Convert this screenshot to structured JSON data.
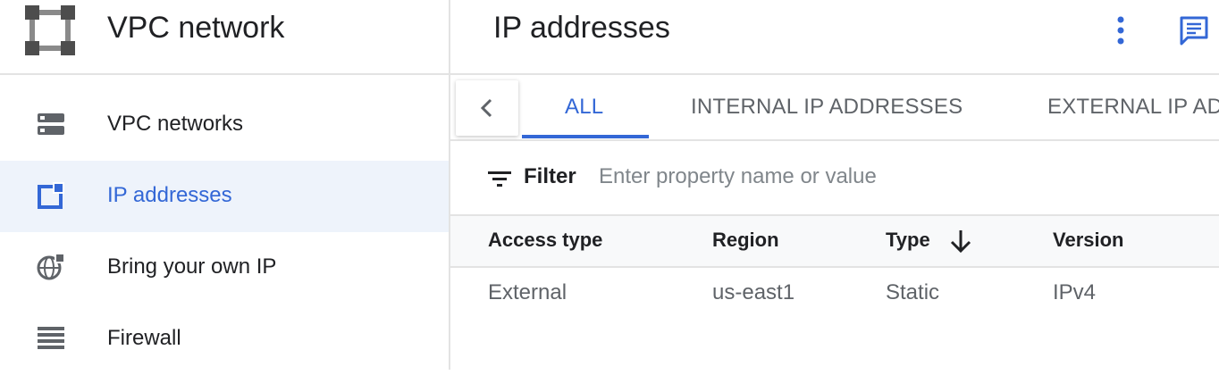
{
  "product": {
    "title": "VPC network",
    "logo_icon": "vpc-network-logo-icon"
  },
  "sidebar": {
    "items": [
      {
        "label": "VPC networks",
        "icon": "vpc-networks-icon",
        "active": false
      },
      {
        "label": "IP addresses",
        "icon": "ip-addresses-icon",
        "active": true
      },
      {
        "label": "Bring your own IP",
        "icon": "globe-icon",
        "active": false
      },
      {
        "label": "Firewall",
        "icon": "firewall-icon",
        "active": false
      }
    ]
  },
  "header": {
    "title": "IP addresses",
    "more_icon": "more-vert-icon",
    "feedback_icon": "feedback-icon"
  },
  "tabs": [
    {
      "label": "ALL",
      "active": true
    },
    {
      "label": "INTERNAL IP ADDRESSES",
      "active": false
    },
    {
      "label": "EXTERNAL IP AD",
      "active": false
    }
  ],
  "filter": {
    "label": "Filter",
    "placeholder": "Enter property name or value",
    "value": ""
  },
  "table": {
    "columns": [
      "Access type",
      "Region",
      "Type",
      "Version"
    ],
    "sort_icon": "arrow-down-icon",
    "rows": [
      [
        "External",
        "us-east1",
        "Static",
        "IPv4"
      ]
    ]
  },
  "colors": {
    "accent": "#3367d6",
    "active_bg": "#eef3fb",
    "icon_gray": "#5f6368",
    "border": "#e3e3e3"
  }
}
